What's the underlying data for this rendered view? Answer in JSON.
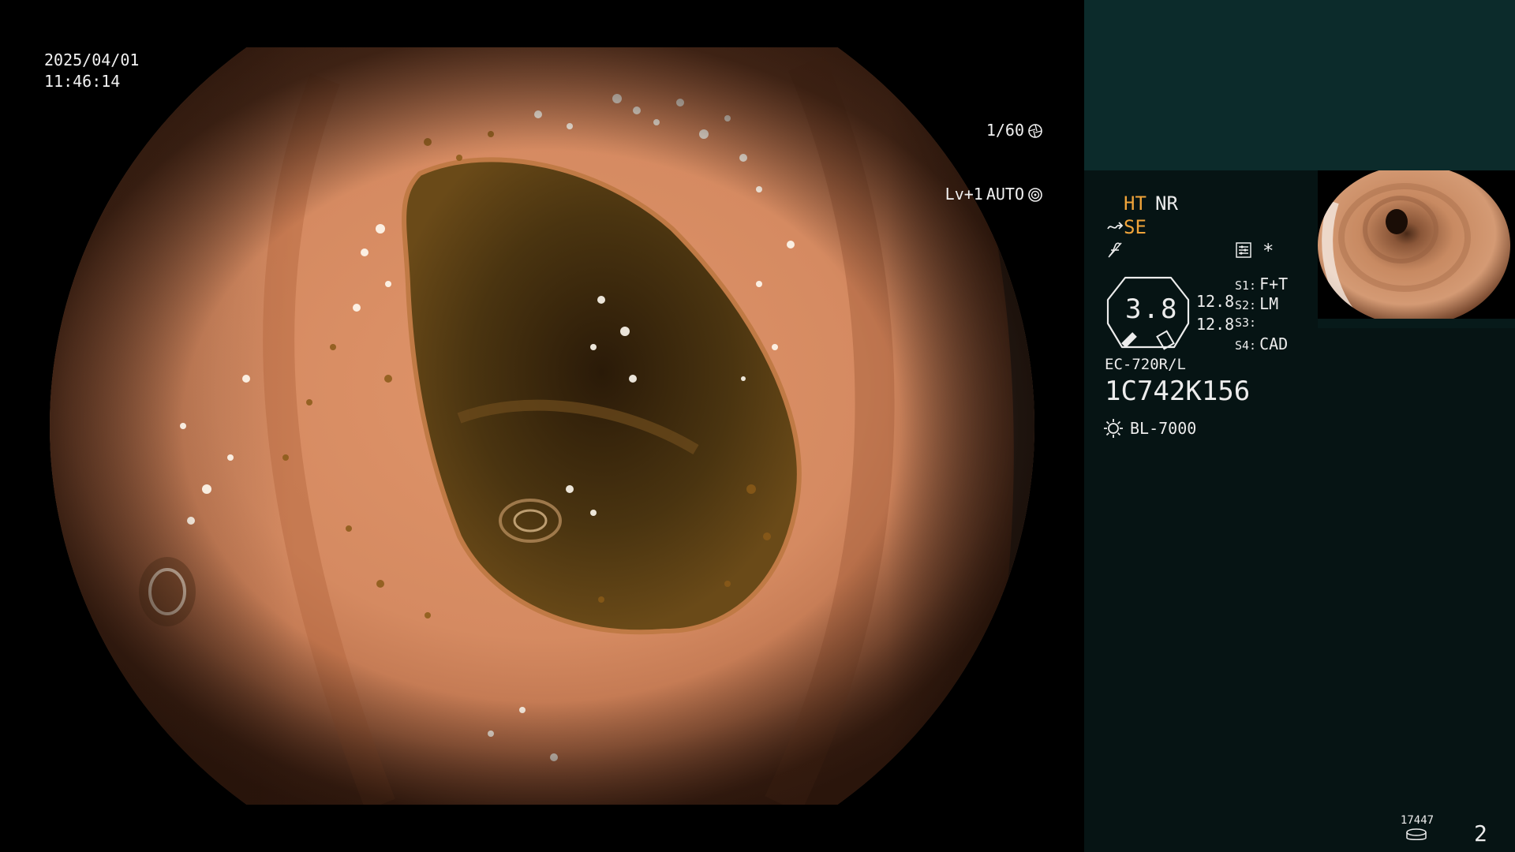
{
  "overlay": {
    "date": "2025/04/01",
    "time": "11:46:14",
    "shutter": "1/60",
    "level": "Lv+1",
    "exposure_mode": "AUTO",
    "shutter_icon": "aperture-icon",
    "auto_icon": "target-icon"
  },
  "panel": {
    "mode_ht": "HT",
    "mode_nr": "NR",
    "mode_se": "SE",
    "mode_se_icon": "tilde-arrow-icon",
    "mode_f_icon": "f-slash-icon",
    "settings_icon": "list-settings-icon",
    "asterisk": "*",
    "zoom_value": "3.8",
    "value_top": "12.8",
    "value_bottom": "12.8",
    "switches": [
      {
        "key": "S1:",
        "value": "F+T"
      },
      {
        "key": "S2:",
        "value": "LM"
      },
      {
        "key": "S3:",
        "value": ""
      },
      {
        "key": "S4:",
        "value": "CAD"
      }
    ],
    "scope_model": "EC-720R/L",
    "scope_serial": "1C742K156",
    "light_icon": "sun-icon",
    "light_source": "BL-7000",
    "counter": "17447",
    "disk_icon": "disk-icon",
    "page_number": "2"
  },
  "colors": {
    "accent_orange": "#f0a43a",
    "panel_bg": "#061414",
    "panel_top_bg": "#0c2b2b"
  }
}
